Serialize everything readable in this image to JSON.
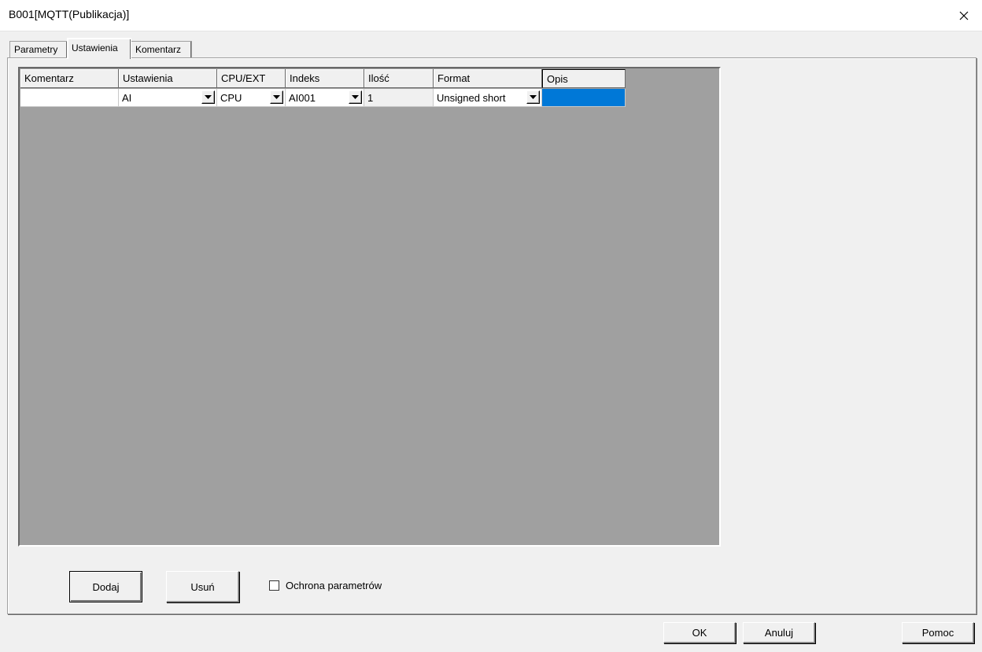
{
  "window": {
    "title": "B001[MQTT(Publikacja)]"
  },
  "tabs": [
    {
      "label": "Parametry",
      "active": false
    },
    {
      "label": "Ustawienia",
      "active": true
    },
    {
      "label": "Komentarz",
      "active": false
    }
  ],
  "grid": {
    "columns": [
      "Komentarz",
      "Ustawienia",
      "CPU/EXT",
      "Indeks",
      "Ilość",
      "Format",
      "Opis"
    ],
    "rows": [
      {
        "komentarz": "",
        "ustawienia": "AI",
        "cpu_ext": "CPU",
        "indeks": "AI001",
        "ilosc": "1",
        "format": "Unsigned short",
        "opis": ""
      }
    ]
  },
  "actions": {
    "add_label": "Dodaj",
    "remove_label": "Usuń",
    "protect_label": "Ochrona parametrów",
    "protect_checked": false
  },
  "dialog_buttons": {
    "ok_label": "OK",
    "cancel_label": "Anuluj",
    "help_label": "Pomoc"
  },
  "colors": {
    "grid_background": "#a0a0a0",
    "selection": "#0078d7"
  }
}
